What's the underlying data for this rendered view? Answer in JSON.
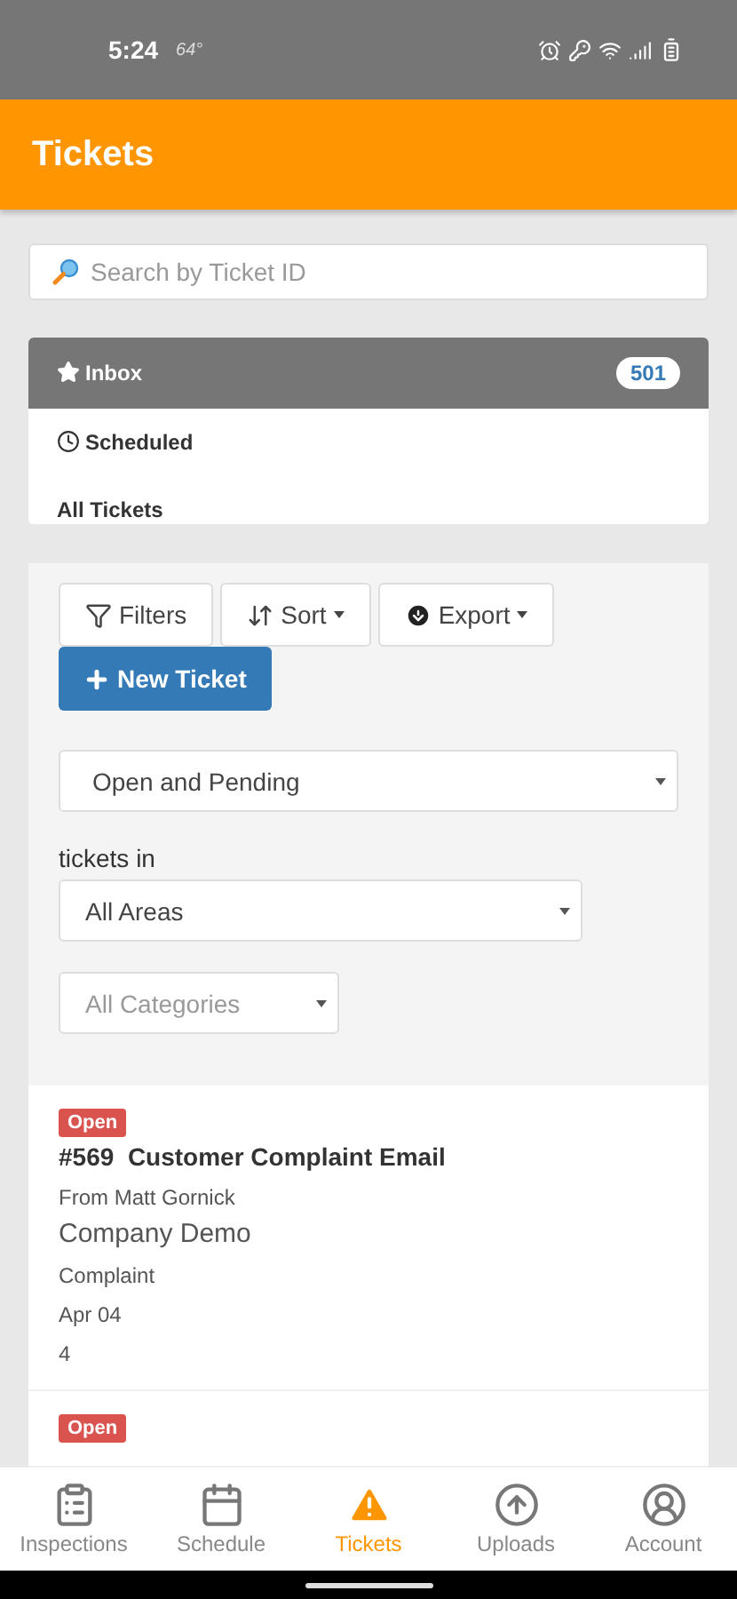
{
  "status_bar": {
    "time": "5:24",
    "temperature": "64°"
  },
  "app_bar": {
    "title": "Tickets"
  },
  "search": {
    "placeholder": "Search by Ticket ID"
  },
  "folders": [
    {
      "label": "Inbox",
      "selected": true,
      "badge": "501"
    },
    {
      "label": "Scheduled",
      "selected": false
    },
    {
      "label": "All Tickets",
      "selected": false
    }
  ],
  "toolbar": {
    "buttons": [
      {
        "label": "Filters",
        "dropdown": false
      },
      {
        "label": "Sort",
        "dropdown": true
      },
      {
        "label": "Export",
        "dropdown": true
      }
    ],
    "new_ticket": "New Ticket"
  },
  "status_select": {
    "value": "Open and Pending"
  },
  "tickets_in_label": "tickets in",
  "area_select": {
    "value": "All Areas"
  },
  "category_select": {
    "placeholder": "All Categories"
  },
  "tickets": [
    {
      "status": "Open",
      "number": "#569",
      "title": "Customer Complaint Email",
      "from": "From Matt Gornick",
      "company": "Company Demo",
      "category": "Complaint",
      "date": "Apr 04",
      "count": "4"
    },
    {
      "status": "Open"
    }
  ],
  "nav": [
    {
      "label": "Inspections",
      "selected": false
    },
    {
      "label": "Schedule",
      "selected": false
    },
    {
      "label": "Tickets",
      "selected": true
    },
    {
      "label": "Uploads",
      "selected": false
    },
    {
      "label": "Account",
      "selected": false
    }
  ]
}
